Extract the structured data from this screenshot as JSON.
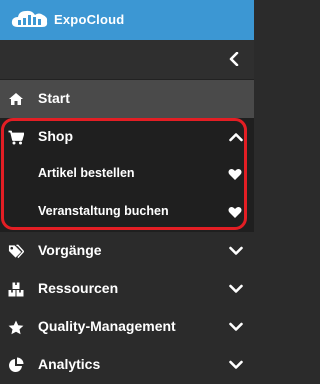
{
  "app": {
    "name": "ExpoCloud"
  },
  "colors": {
    "header": "#3c97d3",
    "sidebar": "#2b2b2b",
    "active": "#4a4a4a",
    "highlight": "#e31e24"
  },
  "nav": {
    "start": {
      "label": "Start",
      "icon": "home-icon"
    },
    "shop": {
      "label": "Shop",
      "icon": "cart-icon",
      "expanded": true,
      "children": [
        {
          "label": "Artikel bestellen",
          "icon": "heart-icon"
        },
        {
          "label": "Veranstaltung buchen",
          "icon": "heart-icon"
        }
      ]
    },
    "vorgaenge": {
      "label": "Vorgänge",
      "icon": "tags-icon"
    },
    "ressourcen": {
      "label": "Ressourcen",
      "icon": "boxes-icon"
    },
    "quality": {
      "label": "Quality-Management",
      "icon": "star-icon"
    },
    "analytics": {
      "label": "Analytics",
      "icon": "pie-chart-icon"
    }
  }
}
